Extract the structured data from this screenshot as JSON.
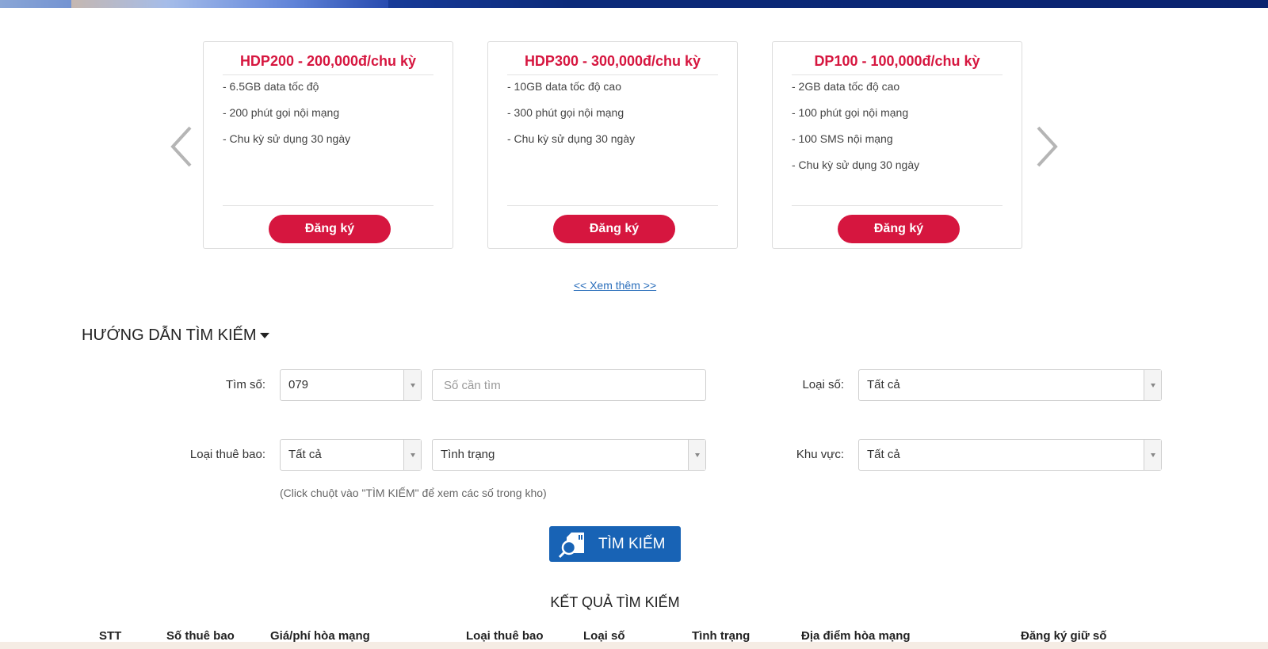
{
  "colors": {
    "accent_red": "#d6163f",
    "link_blue": "#2a6ebb",
    "button_blue": "#1863b5"
  },
  "carousel": {
    "prev_icon": "chevron-left-icon",
    "next_icon": "chevron-right-icon",
    "packages": [
      {
        "title": "HDP200 - 200,000đ/chu kỳ",
        "features": [
          "- 6.5GB data tốc độ",
          "- 200 phút gọi nội mạng",
          "- Chu kỳ sử dụng 30 ngày"
        ],
        "button": "Đăng ký"
      },
      {
        "title": "HDP300 - 300,000đ/chu kỳ",
        "features": [
          "- 10GB data tốc độ cao",
          "- 300 phút gọi nội mạng",
          "- Chu kỳ sử dụng 30 ngày"
        ],
        "button": "Đăng ký"
      },
      {
        "title": "DP100 - 100,000đ/chu kỳ",
        "features": [
          "- 2GB data tốc độ cao",
          "- 100 phút gọi nội mạng",
          "- 100 SMS nội mạng",
          "- Chu kỳ sử dụng 30 ngày"
        ],
        "button": "Đăng ký"
      }
    ],
    "see_more": "<< Xem thêm >>"
  },
  "search": {
    "section_title": "HƯỚNG DẪN TÌM KIẾM",
    "number_label": "Tìm số:",
    "prefix_value": "079",
    "number_placeholder": "Số cần tìm",
    "number_type_label": "Loại số:",
    "number_type_value": "Tất cả",
    "subscriber_type_label": "Loại thuê bao:",
    "subscriber_type_value": "Tất cả",
    "status_value": "Tình trạng",
    "region_label": "Khu vực:",
    "region_value": "Tất cả",
    "hint": "(Click chuột vào \"TÌM KIẾM\" để xem các số trong kho)",
    "button": "TÌM KIẾM",
    "button_icon": "sim-search-icon"
  },
  "results": {
    "title": "KẾT QUẢ TÌM KIẾM",
    "columns": [
      "STT",
      "Số thuê bao",
      "Giá/phí hòa mạng",
      "Loại thuê bao",
      "Loại số",
      "Tình trạng",
      "Địa điểm hòa mạng",
      "Đăng ký giữ số"
    ]
  }
}
